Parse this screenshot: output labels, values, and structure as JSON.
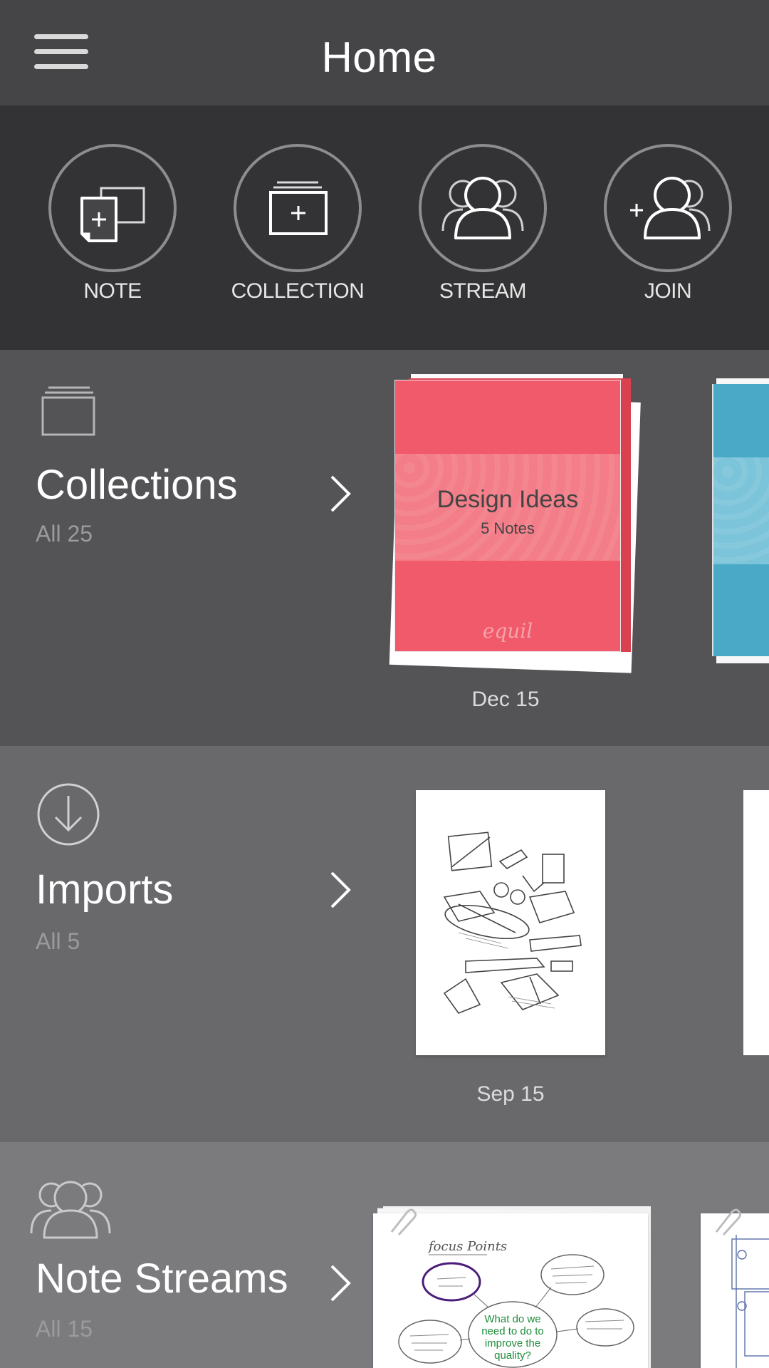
{
  "header": {
    "title": "Home",
    "menu_icon": "hamburger-menu-icon"
  },
  "actions": [
    {
      "label": "NOTE",
      "icon": "new-note-icon"
    },
    {
      "label": "COLLECTION",
      "icon": "new-collection-icon"
    },
    {
      "label": "STREAM",
      "icon": "stream-people-icon"
    },
    {
      "label": "JOIN",
      "icon": "join-stream-icon"
    }
  ],
  "collections": {
    "title": "Collections",
    "count": "All 25",
    "icon": "collection-stack-icon",
    "card": {
      "title": "Design Ideas",
      "subtitle": "5 Notes",
      "brand": "equil",
      "date": "Dec 15",
      "color": "#f05a6a"
    },
    "next_card_color": "#4aa9c6"
  },
  "imports": {
    "title": "Imports",
    "count": "All 5",
    "icon": "download-circle-icon",
    "card": {
      "date": "Sep 15"
    }
  },
  "streams": {
    "title": "Note Streams",
    "count": "All 15",
    "icon": "people-group-icon",
    "card": {
      "heading": "focus Points",
      "question": "What do we need to do to improve the quality?"
    }
  },
  "colors": {
    "header_bg": "#454548",
    "actions_bg": "#333335",
    "collections_bg": "#545457",
    "imports_bg": "#69696c",
    "streams_bg": "#7b7b7e"
  }
}
